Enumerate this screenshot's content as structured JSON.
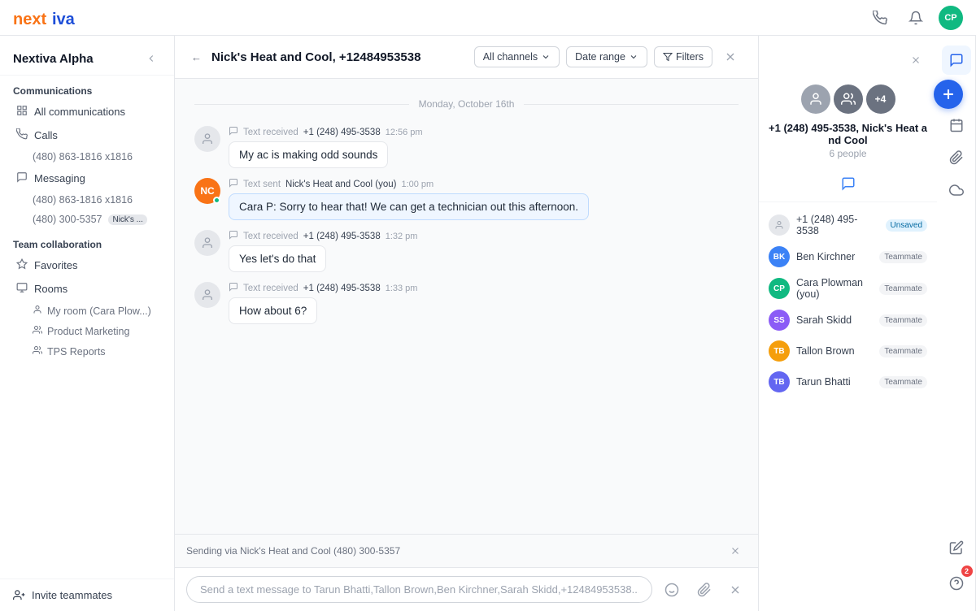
{
  "topbar": {
    "logo": "nextiva",
    "icons": [
      "phone",
      "bell",
      "user"
    ],
    "avatar_initials": "CP"
  },
  "sidebar": {
    "title": "Nextiva Alpha",
    "sections": {
      "communications": {
        "label": "Communications",
        "items": [
          {
            "id": "all-comms",
            "label": "All communications",
            "icon": "grid"
          },
          {
            "id": "calls",
            "label": "Calls",
            "icon": "phone",
            "sub": [
              {
                "label": "(480) 863-1816 x1816"
              }
            ]
          },
          {
            "id": "messaging",
            "label": "Messaging",
            "icon": "message",
            "sub": [
              {
                "label": "(480) 863-1816 x1816"
              },
              {
                "label": "(480) 300-5357",
                "badge": "Nick's ..."
              }
            ]
          }
        ]
      },
      "team": {
        "label": "Team collaboration",
        "items": [
          {
            "id": "favorites",
            "label": "Favorites",
            "icon": "star"
          },
          {
            "id": "rooms",
            "label": "Rooms",
            "icon": "book",
            "sub": [
              {
                "label": "My room (Cara Plow...)",
                "icon": "person"
              },
              {
                "label": "Product Marketing",
                "icon": "persons"
              },
              {
                "label": "TPS Reports",
                "icon": "persons"
              }
            ]
          }
        ]
      }
    },
    "footer": {
      "label": "Invite teammates",
      "icon": "person-plus"
    }
  },
  "chat_header": {
    "back": "←",
    "title": "Nick's Heat and Cool, +12484953538",
    "channel_filter": "All channels",
    "date_filter": "Date range",
    "filters_label": "Filters"
  },
  "chat": {
    "date_divider": "Monday, October 16th",
    "messages": [
      {
        "id": "msg1",
        "type": "received",
        "icon": "message",
        "meta_prefix": "Text received",
        "sender": "+1 (248) 495-3538",
        "time": "12:56 pm",
        "text": "My ac is making odd sounds"
      },
      {
        "id": "msg2",
        "type": "sent",
        "icon": "message",
        "meta_prefix": "Text sent",
        "sender": "Nick's Heat and Cool (you)",
        "time": "1:00 pm",
        "text": "Cara P: Sorry to hear that! We can get a technician out this afternoon."
      },
      {
        "id": "msg3",
        "type": "received",
        "icon": "message",
        "meta_prefix": "Text received",
        "sender": "+1 (248) 495-3538",
        "time": "1:32 pm",
        "text": "Yes let's do that"
      },
      {
        "id": "msg4",
        "type": "received",
        "icon": "message",
        "meta_prefix": "Text received",
        "sender": "+1 (248) 495-3538",
        "time": "1:33 pm",
        "text": "How about 6?"
      }
    ]
  },
  "compose": {
    "banner": "Sending via Nick's Heat and Cool (480) 300-5357",
    "placeholder": "Send a text message to Tarun Bhatti,Tallon Brown,Ben Kirchner,Sarah Skidd,+12484953538..."
  },
  "right_panel": {
    "group_name": "+1 (248) 495-3538, Nick's Heat a nd Cool",
    "people_count": "6 people",
    "plus_count": "+4",
    "people": [
      {
        "id": "unsaved",
        "phone": "+1 (248) 495-3538",
        "badge": "Unsaved",
        "badge_type": "unsaved",
        "color": "#9ca3af",
        "initials": ""
      },
      {
        "id": "ben",
        "name": "Ben Kirchner",
        "badge": "Teammate",
        "color": "#3b82f6",
        "initials": "BK"
      },
      {
        "id": "cara",
        "name": "Cara Plowman (you)",
        "badge": "Teammate",
        "color": "#10b981",
        "initials": "CP"
      },
      {
        "id": "sarah",
        "name": "Sarah Skidd",
        "badge": "Teammate",
        "color": "#8b5cf6",
        "initials": "SS"
      },
      {
        "id": "tallon",
        "name": "Tallon Brown",
        "badge": "Teammate",
        "color": "#f59e0b",
        "initials": "TB"
      },
      {
        "id": "tarun",
        "name": "Tarun Bhatti",
        "badge": "Teammate",
        "color": "#6366f1",
        "initials": "TB"
      }
    ]
  }
}
